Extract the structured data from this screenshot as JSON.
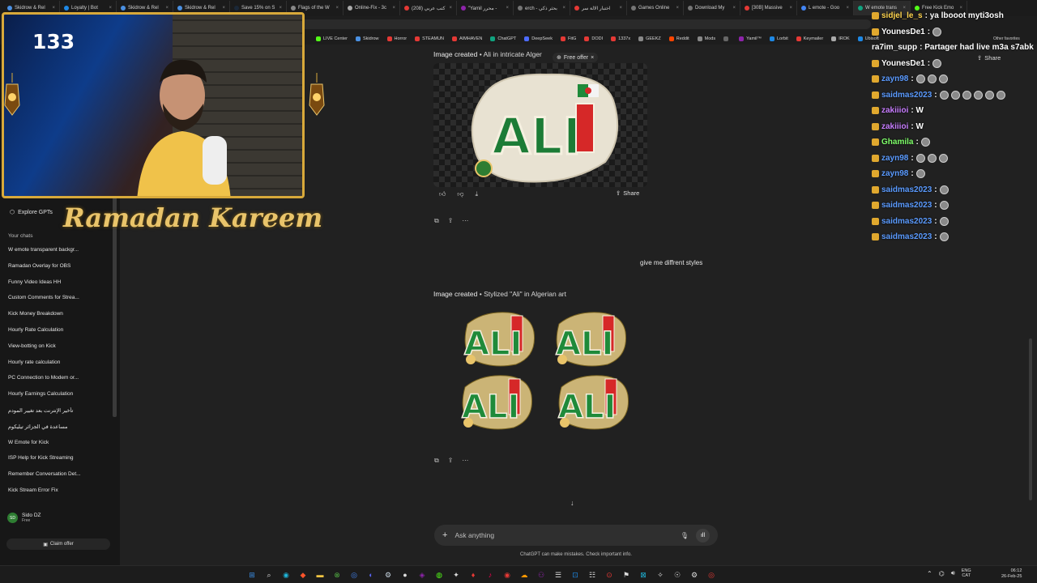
{
  "browser": {
    "tabs": [
      {
        "label": "Skidrow & Rel",
        "color": "#4a90e2"
      },
      {
        "label": "Loyalty | Bot",
        "color": "#1e88e5"
      },
      {
        "label": "Skidrow & Rel",
        "color": "#4a90e2"
      },
      {
        "label": "Skidrow & Rel",
        "color": "#4a90e2"
      },
      {
        "label": "Save 15% on S",
        "color": "#1b2838"
      },
      {
        "label": "Flags of the W",
        "color": "#888888"
      },
      {
        "label": "Online-Fix - 3c",
        "color": "#aaaaaa"
      },
      {
        "label": "كتب عربي (208)",
        "color": "#e53935"
      },
      {
        "label": "\"Yamil محرر - ",
        "color": "#8e24aa"
      },
      {
        "label": "erch - بحثر ذكي",
        "color": "#757575"
      },
      {
        "label": "اختبار الالة سر",
        "color": "#e53935"
      },
      {
        "label": "Games Online",
        "color": "#757575"
      },
      {
        "label": "Download My",
        "color": "#757575"
      },
      {
        "label": "[30B] Massive",
        "color": "#e53935"
      },
      {
        "label": "L emote - Goo",
        "color": "#4285f4"
      },
      {
        "label": "W emote trans",
        "color": "#10a37f"
      },
      {
        "label": "Free Kick Emo",
        "color": "#53fc18"
      }
    ],
    "bookmarks": [
      {
        "label": "LIVE Center",
        "color": "#53fc18"
      },
      {
        "label": "Skidrow",
        "color": "#4a90e2"
      },
      {
        "label": "Horror",
        "color": "#e53935"
      },
      {
        "label": "STEAMUN",
        "color": "#e53935"
      },
      {
        "label": "AIMHAVEN",
        "color": "#e53935"
      },
      {
        "label": "ChatGPT",
        "color": "#10a37f"
      },
      {
        "label": "DeepSeek",
        "color": "#4d6bfe"
      },
      {
        "label": "FitG",
        "color": "#e53935"
      },
      {
        "label": "DODI",
        "color": "#e53935"
      },
      {
        "label": "1337x",
        "color": "#e53935"
      },
      {
        "label": "GEEKZ",
        "color": "#888888"
      },
      {
        "label": "Reddit",
        "color": "#ff4500"
      },
      {
        "label": "Mods",
        "color": "#888888"
      },
      {
        "label": "",
        "color": "#666666"
      },
      {
        "label": "Yamil™",
        "color": "#8e24aa"
      },
      {
        "label": "Lorbit",
        "color": "#1e88e5"
      },
      {
        "label": "Keymailer",
        "color": "#e53935"
      },
      {
        "label": "IROK",
        "color": "#aaaaaa"
      },
      {
        "label": "Ubisoft",
        "color": "#1e88e5"
      }
    ],
    "other_favorites": "Other favorites"
  },
  "sidebar": {
    "explore": "Explore GPTs",
    "your_chats": "Your chats",
    "chats": [
      "W emote transparent backgr...",
      "Ramadan Overlay for OBS",
      "Funny Video Ideas HH",
      "Custom Comments for Strea...",
      "Kick Money Breakdown",
      "Hourly Rate Calculation",
      "View-botting on Kick",
      "Hourly rate calculation",
      "PC Connection to Modem or...",
      "Hourly Earnings Calculation",
      "تأخير الإنترنت بعد تغيير المودم",
      "مساعدة في الجزائر تيليكوم",
      "W Emote for Kick",
      "ISP Help for Kick Streaming",
      "Remember Conversation Det...",
      "Kick Stream Error Fix"
    ],
    "user_name": "Sido DZ",
    "user_plan": "Free",
    "claim_offer": "Claim offer"
  },
  "conversation": {
    "image1_label": "Image created",
    "image1_title": "Ali in intricate Alger",
    "free_offer": "Free offer",
    "share": "Share",
    "user_message": "give me diffrent styles",
    "image2_label": "Image created",
    "image2_title": "Stylized \"Ali\" in Algerian art",
    "art_text": "ALI"
  },
  "composer": {
    "placeholder": "Ask anything",
    "disclaimer": "ChatGPT can make mistakes. Check important info."
  },
  "stream": {
    "viewer_count": "133",
    "ramadan_text": "Ramadan Kareem",
    "chat": [
      {
        "user": "sidjel_le_s",
        "text": ": ya lbooot myti3osh",
        "color": "#ffd54f",
        "badge": true,
        "emotes": 0
      },
      {
        "user": "YounesDe1",
        "text": ":",
        "color": "#ffffff",
        "badge": true,
        "emotes": 1
      },
      {
        "user": "ra7im_supp",
        "text": ": Partager had live m3a s7abk",
        "color": "#ffffff",
        "badge": false,
        "emotes": 0
      },
      {
        "user": "YounesDe1",
        "text": ":",
        "color": "#ffffff",
        "badge": true,
        "emotes": 1
      },
      {
        "user": "zayn98",
        "text": ":",
        "color": "#5b9bff",
        "badge": true,
        "emotes": 3
      },
      {
        "user": "saidmas2023",
        "text": ":",
        "color": "#5b9bff",
        "badge": true,
        "emotes": 6
      },
      {
        "user": "zakiiioi",
        "text": ": W",
        "color": "#c77dff",
        "badge": true,
        "emotes": 0
      },
      {
        "user": "zakiiioi",
        "text": ": W",
        "color": "#c77dff",
        "badge": true,
        "emotes": 0
      },
      {
        "user": "Ghamila",
        "text": ":",
        "color": "#7fff6a",
        "badge": true,
        "emotes": 1
      },
      {
        "user": "zayn98",
        "text": ":",
        "color": "#5b9bff",
        "badge": true,
        "emotes": 3
      },
      {
        "user": "zayn98",
        "text": ":",
        "color": "#5b9bff",
        "badge": true,
        "emotes": 1
      },
      {
        "user": "saidmas2023",
        "text": ":",
        "color": "#5b9bff",
        "badge": true,
        "emotes": 1
      },
      {
        "user": "saidmas2023",
        "text": ":",
        "color": "#5b9bff",
        "badge": true,
        "emotes": 1
      },
      {
        "user": "saidmas2023",
        "text": ":",
        "color": "#5b9bff",
        "badge": true,
        "emotes": 1
      },
      {
        "user": "saidmas2023",
        "text": ":",
        "color": "#5b9bff",
        "badge": true,
        "emotes": 1
      }
    ]
  },
  "taskbar": {
    "lang_top": "ENG",
    "lang_bottom": "CAT",
    "time": "06:12",
    "date": "26-Feb-25"
  }
}
